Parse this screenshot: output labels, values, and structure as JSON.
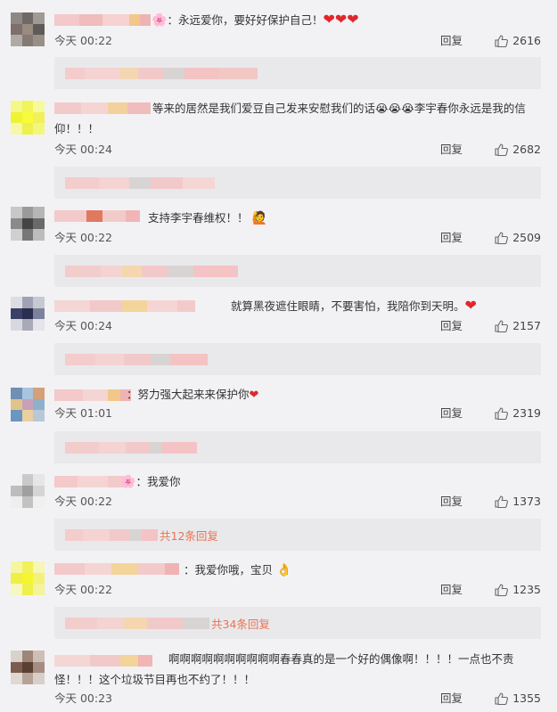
{
  "ui": {
    "reply_label": "回复"
  },
  "comments": [
    {
      "text": "：永远爱你，要好好保护自己！",
      "hearts": "❤❤❤",
      "time": "今天 00:22",
      "likes": "2616",
      "more_replies": ""
    },
    {
      "text": "等来的居然是我们爱豆自己发来安慰我们的话😭😭😭李宇春你永远是我的信仰！！！",
      "prefix_emoji": "😭😭😭",
      "time": "今天 00:24",
      "likes": "2682",
      "more_replies": ""
    },
    {
      "text": "支持李宇春维权！！",
      "emoji": "🙋",
      "time": "今天 00:22",
      "likes": "2509",
      "more_replies": ""
    },
    {
      "text": "就算黑夜遮住眼睛，不要害怕，我陪你到天明。",
      "hearts": "❤",
      "time": "今天 00:24",
      "likes": "2157",
      "more_replies": ""
    },
    {
      "text": "：努力强大起来来保护你",
      "hearts": "❤",
      "time": "今天 01:01",
      "likes": "2319",
      "more_replies": ""
    },
    {
      "text": "：我爱你",
      "time": "今天 00:22",
      "likes": "1373",
      "more_replies": "共12条回复"
    },
    {
      "text": "：我爱你哦，宝贝",
      "emoji": "👌",
      "time": "今天 00:22",
      "likes": "1235",
      "more_replies": "共34条回复"
    },
    {
      "text": "啊啊啊啊啊啊啊啊啊啊春春真的是一个好的偶像啊！！！！一点也不责怪！！！这个垃圾节目再也不约了！！！",
      "time": "今天 00:23",
      "likes": "1355",
      "more_replies": ""
    }
  ]
}
